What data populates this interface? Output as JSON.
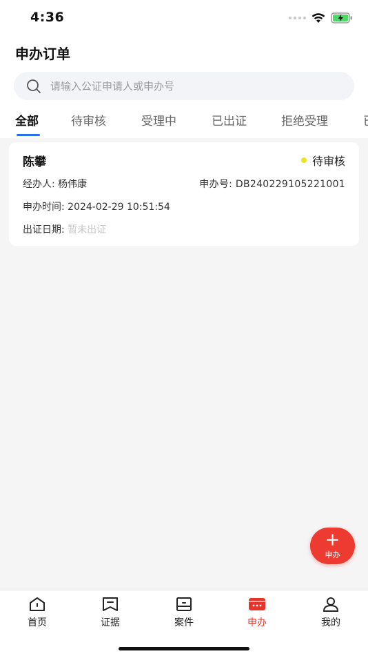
{
  "status_bar": {
    "time": "4:36"
  },
  "header": {
    "title": "申办订单"
  },
  "search": {
    "placeholder": "请输入公证申请人或申办号",
    "value": ""
  },
  "tabs": [
    {
      "label": "全部",
      "active": true
    },
    {
      "label": "待审核"
    },
    {
      "label": "受理中"
    },
    {
      "label": "已出证"
    },
    {
      "label": "拒绝受理"
    },
    {
      "label": "已"
    }
  ],
  "orders": [
    {
      "name": "陈攀",
      "status": "待审核",
      "status_color": "#f0e124",
      "handler_label": "经办人:",
      "handler": "杨伟康",
      "order_no_label": "申办号:",
      "order_no": "DB240229105221001",
      "time_label": "申办时间:",
      "time": "2024-02-29 10:51:54",
      "cert_date_label": "出证日期:",
      "cert_date": "暂未出证"
    }
  ],
  "fab": {
    "plus": "+",
    "label": "申办",
    "color": "#ee3b32"
  },
  "bottom_nav": [
    {
      "label": "首页",
      "icon": "home-icon"
    },
    {
      "label": "证据",
      "icon": "evidence-icon"
    },
    {
      "label": "案件",
      "icon": "case-icon"
    },
    {
      "label": "申办",
      "icon": "apply-icon",
      "active": true
    },
    {
      "label": "我的",
      "icon": "user-icon"
    }
  ],
  "colors": {
    "accent_blue": "#2a70e8",
    "active_red": "#e8332b"
  }
}
